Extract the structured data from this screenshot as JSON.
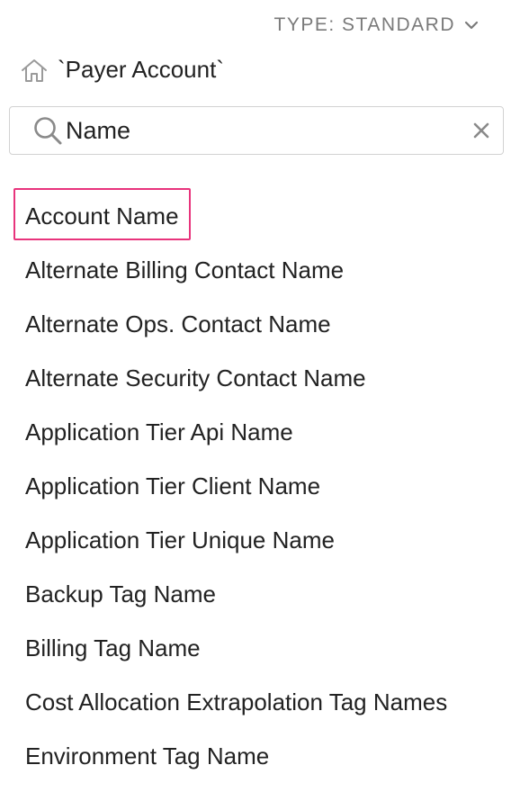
{
  "type_selector": {
    "label": "TYPE: STANDARD",
    "icon": "chevron-down-icon"
  },
  "breadcrumb": {
    "icon": "home-icon",
    "label": "`Payer Account`"
  },
  "search": {
    "value": "Name",
    "icon": "search-icon",
    "clear_icon": "close-icon"
  },
  "results": [
    {
      "label": "Account Name",
      "selected": true
    },
    {
      "label": "Alternate Billing Contact Name"
    },
    {
      "label": "Alternate Ops. Contact Name"
    },
    {
      "label": "Alternate Security Contact Name"
    },
    {
      "label": "Application Tier Api Name"
    },
    {
      "label": "Application Tier Client Name"
    },
    {
      "label": "Application Tier Unique Name"
    },
    {
      "label": "Backup Tag Name"
    },
    {
      "label": "Billing Tag Name"
    },
    {
      "label": "Cost Allocation Extrapolation Tag Names"
    },
    {
      "label": "Environment Tag Name"
    }
  ],
  "colors": {
    "selection_border": "#e8347c",
    "muted_text": "#7a7a7a",
    "text": "#222222"
  }
}
